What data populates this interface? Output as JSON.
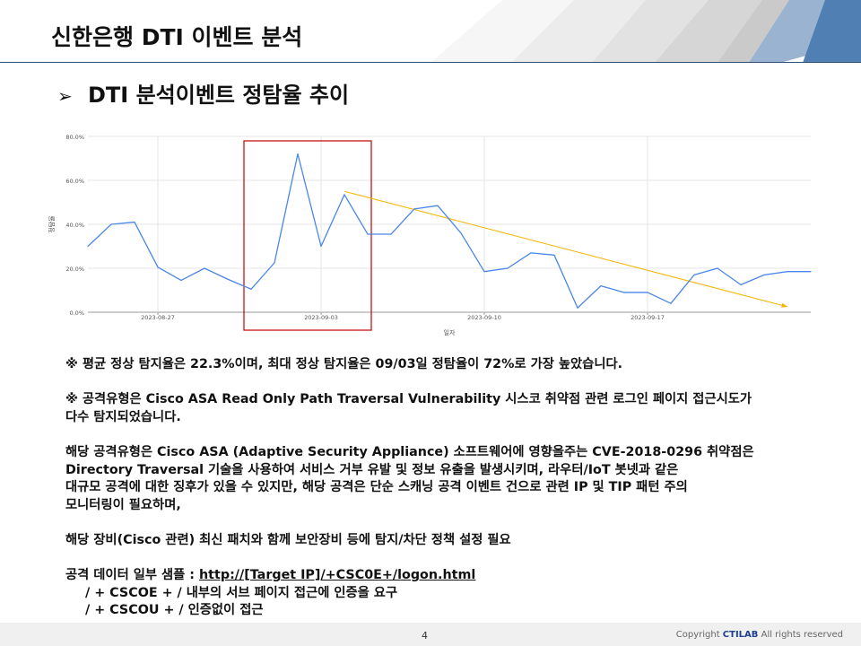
{
  "header": {
    "title": "신한은행 DTI 이벤트 분석"
  },
  "section": {
    "bullet": "➢",
    "title": "DTI 분석이벤트 정탐율 추이"
  },
  "chart_data": {
    "type": "line",
    "title": "",
    "xlabel": "일자",
    "ylabel": "정탐율",
    "ylim": [
      0,
      80
    ],
    "y_ticks": [
      "0.0%",
      "20.0%",
      "40.0%",
      "60.0%",
      "80.0%"
    ],
    "x_ticks": [
      "2023-08-27",
      "2023-09-03",
      "2023-09-10",
      "2023-09-17"
    ],
    "grid": true,
    "x": [
      "2023-08-24",
      "2023-08-25",
      "2023-08-26",
      "2023-08-27",
      "2023-08-28",
      "2023-08-29",
      "2023-08-30",
      "2023-08-31",
      "2023-09-01",
      "2023-09-02",
      "2023-09-03",
      "2023-09-04",
      "2023-09-05",
      "2023-09-06",
      "2023-09-07",
      "2023-09-08",
      "2023-09-09",
      "2023-09-10",
      "2023-09-11",
      "2023-09-12",
      "2023-09-13",
      "2023-09-14",
      "2023-09-15",
      "2023-09-16",
      "2023-09-17",
      "2023-09-18",
      "2023-09-19",
      "2023-09-20",
      "2023-09-21",
      "2023-09-22",
      "2023-09-23",
      "2023-09-24"
    ],
    "series": [
      {
        "values": [
          30,
          40,
          41,
          20.5,
          14.5,
          20,
          15,
          10.5,
          22.5,
          72,
          30,
          53.5,
          35.5,
          35.5,
          47,
          48.5,
          36,
          18.5,
          20,
          27,
          26,
          2,
          12,
          9,
          9,
          4,
          17,
          20,
          12.5,
          17,
          18.5,
          18.5
        ],
        "color": "#4a86e8"
      }
    ],
    "trend": {
      "from": [
        "2023-09-04",
        55
      ],
      "to": [
        "2023-09-23",
        2.5
      ],
      "color": "#f4b400"
    },
    "highlight": {
      "from": "2023-08-31",
      "to": "2023-09-05",
      "color": "#c00000"
    }
  },
  "body": {
    "p1": "※ 평균 정상 탐지율은 22.3%이며, 최대 정상 탐지율은 09/03일 정탐율이 72%로 가장 높았습니다.",
    "p2a": "※ 공격유형은 Cisco ASA Read Only Path Traversal Vulnerability 시스코 취약점 관련 로그인 페이지 접근시도가",
    "p2b": "다수 탐지되었습니다.",
    "p3a": "해당 공격유형은 Cisco ASA (Adaptive Security Appliance) 소프트웨어에 영향을주는 CVE-2018-0296 취약점은",
    "p3b": "Directory Traversal 기술을 사용하여 서비스 거부 유발 및 정보 유출을 발생시키며, 라우터/IoT 봇넷과 같은",
    "p3c": "대규모 공격에 대한 징후가 있을 수 있지만, 해당 공격은 단순 스캐닝 공격 이벤트 건으로 관련 IP 및 TIP 패턴 주의",
    "p3d": "모니터링이 필요하며,",
    "p4": "해당 장비(Cisco 관련) 최신 패치와 함께 보안장비 등에 탐지/차단 정책 설정 필요",
    "p5_prefix": "공격 데이터 일부 샘플 : ",
    "p5_link": "http://[Target IP]/+CSC0E+/logon.html",
    "p6": "/ + CSCOE  + / 내부의 서브 페이지 접근에 인증을 요구",
    "p7": "/ + CSCOU  + / 인증없이 접근"
  },
  "footer": {
    "page": "4",
    "copyright_prefix": "Copyright ",
    "copyright_brand": "CTILAB",
    "copyright_suffix": " All rights reserved"
  }
}
